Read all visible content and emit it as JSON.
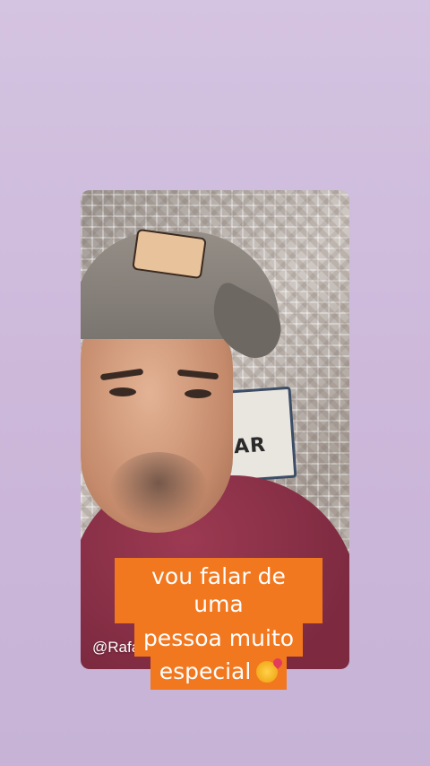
{
  "story": {
    "handle": "@Rafamiler",
    "sign_text": "CAR",
    "caption_lines": [
      "vou falar de uma",
      "pessoa muito",
      "especial"
    ],
    "emoji": "smiling-face-with-hearts-icon"
  },
  "colors": {
    "background": "#d4c3e1",
    "caption_bg": "#f2781f",
    "caption_text": "#ffffff"
  }
}
